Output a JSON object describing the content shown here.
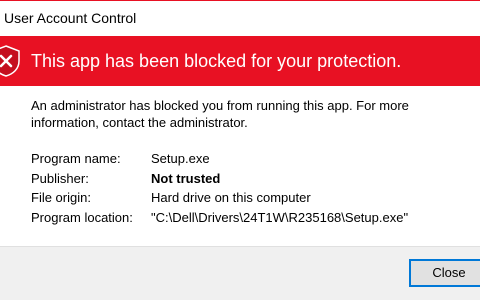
{
  "window": {
    "title": "User Account Control"
  },
  "banner": {
    "headline": "This app has been blocked for your protection.",
    "icon": "shield-x-icon",
    "color": "#e81123"
  },
  "message": "An administrator has blocked you from running this app. For more information, contact the administrator.",
  "details": [
    {
      "label": "Program name:",
      "value": "Setup.exe",
      "bold": false
    },
    {
      "label": "Publisher:",
      "value": "Not trusted",
      "bold": true
    },
    {
      "label": "File origin:",
      "value": "Hard drive on this computer",
      "bold": false
    },
    {
      "label": "Program location:",
      "value": "\"C:\\Dell\\Drivers\\24T1W\\R235168\\Setup.exe\"",
      "bold": false
    }
  ],
  "footer": {
    "close_label": "Close"
  }
}
